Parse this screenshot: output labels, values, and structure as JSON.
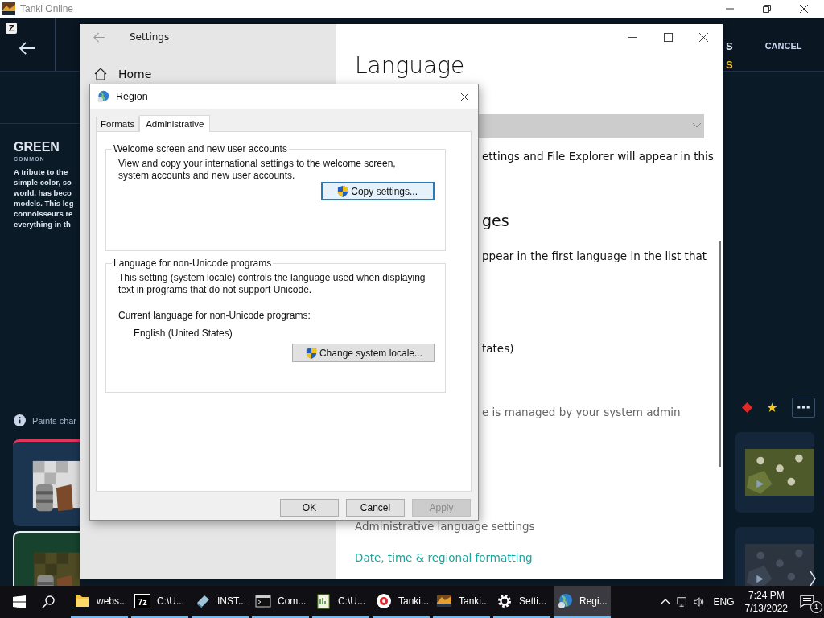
{
  "app": {
    "title": "Tanki Online"
  },
  "game": {
    "badge": "Z",
    "title_fragment": "S",
    "subtitle_fragment": "S",
    "cancel": "CANCEL",
    "paint": {
      "name": "GREEN",
      "rarity": "COMMON",
      "description_lines": [
        "A tribute to the",
        "simple color, so",
        "world, has beco",
        "models. This leg",
        "connoisseurs re",
        "everything in th"
      ]
    },
    "notice": "Paints char",
    "cards_left": [
      {
        "kind": "picture",
        "selected": false
      },
      {
        "kind": "picture",
        "selected": true
      }
    ],
    "cards_right": [
      {
        "kind": "picture"
      },
      {
        "kind": "picture"
      }
    ]
  },
  "settings": {
    "title": "Settings",
    "home": "Home",
    "heading": "Language",
    "text_1": "ettings and File Explorer will appear in this",
    "subheading": "ges",
    "text_2": "ppear in the first language in the list that",
    "text_3": "tates)",
    "managed_note": "e is managed by your system admin",
    "links": [
      {
        "label": "Administrative language settings",
        "kind": "muted"
      },
      {
        "label": "Date, time & regional formatting",
        "kind": "accent"
      }
    ]
  },
  "region": {
    "title": "Region",
    "tabs": [
      {
        "label": "Formats",
        "selected": false
      },
      {
        "label": "Administrative",
        "selected": true
      }
    ],
    "groups": [
      {
        "title": "Welcome screen and new user accounts",
        "text": "View and copy your international settings to the welcome screen, system accounts and new user accounts.",
        "button": {
          "label": "Copy settings...",
          "focused": true
        }
      },
      {
        "title": "Language for non-Unicode programs",
        "text": "This setting (system locale) controls the language used when displaying text in programs that do not support Unicode.",
        "current_label": "Current language for non-Unicode programs:",
        "current_value": "English (United States)",
        "button": {
          "label": "Change system locale...",
          "focused": false
        }
      }
    ],
    "buttons": [
      {
        "label": "OK",
        "disabled": false
      },
      {
        "label": "Cancel",
        "disabled": false
      },
      {
        "label": "Apply",
        "disabled": true
      }
    ]
  },
  "taskbar": {
    "items": [
      {
        "kind": "folder",
        "label": "webs...",
        "running": true,
        "selected": false
      },
      {
        "kind": "archive",
        "icon_label": "7z",
        "label": "C:\\U...",
        "running": true,
        "selected": false
      },
      {
        "kind": "installer",
        "label": "INST...",
        "running": true,
        "selected": false
      },
      {
        "kind": "console",
        "label": "Com...",
        "running": true,
        "selected": false
      },
      {
        "kind": "notepad",
        "label": "C:\\U...",
        "running": true,
        "selected": false
      },
      {
        "kind": "browser",
        "label": "Tanki...",
        "running": true,
        "selected": false
      },
      {
        "kind": "game",
        "label": "Tanki...",
        "running": true,
        "selected": false
      },
      {
        "kind": "settings",
        "label": "Setti...",
        "running": true,
        "selected": false
      },
      {
        "kind": "globe",
        "label": "Regi...",
        "running": true,
        "selected": true
      }
    ],
    "tray": {
      "language": "ENG",
      "time": "7:24 PM",
      "date": "7/13/2022",
      "notifications": "1"
    }
  }
}
